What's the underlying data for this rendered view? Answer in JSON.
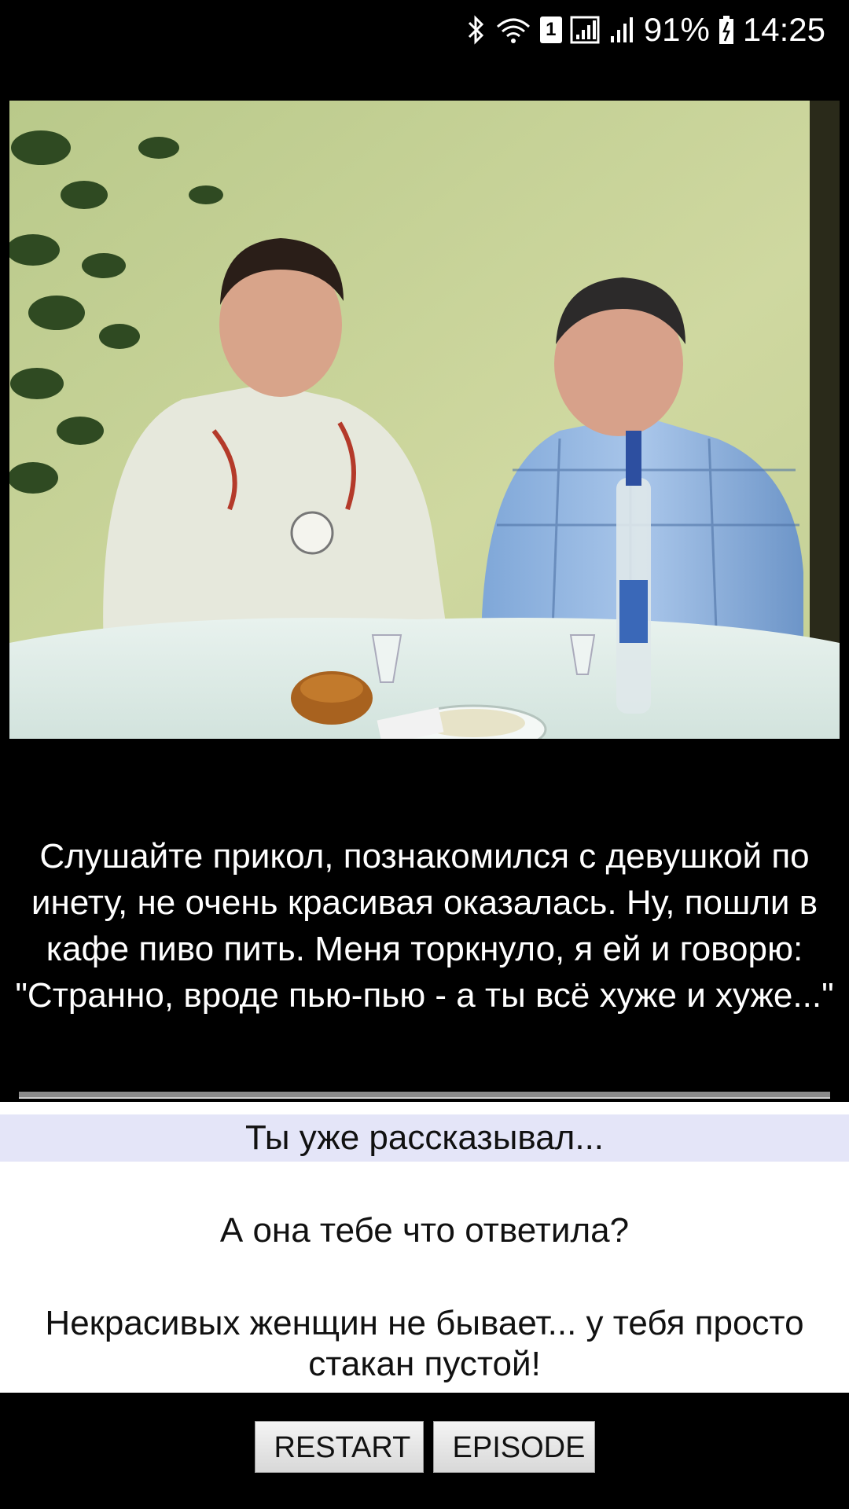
{
  "status_bar": {
    "battery": "91%",
    "time": "14:25",
    "sim_slot": "1",
    "icons": [
      "bluetooth-icon",
      "wifi-icon",
      "sim-icon",
      "signal-icon",
      "signal-icon",
      "battery-icon"
    ]
  },
  "video": {
    "description_icon": "video-still-image"
  },
  "story": {
    "text": "Слушайте прикол, познакомился с девушкой по инету, не очень красивая оказалась. Ну, пошли в кафе пиво пить. Меня торкнуло, я ей и говорю: \"Странно, вроде пью-пью - а ты всё хуже и хуже...\""
  },
  "choices": [
    {
      "label": "Ты уже рассказывал...",
      "highlighted": true
    },
    {
      "label": "А она тебе что ответила?",
      "highlighted": false
    },
    {
      "label": "Некрасивых женщин не бывает... у тебя просто стакан пустой!",
      "highlighted": false
    }
  ],
  "buttons": {
    "restart": "RESTART",
    "episode": "EPISODE"
  },
  "colors": {
    "background": "#000000",
    "choice_highlight": "#e4e5f8",
    "choices_background": "#ffffff"
  }
}
